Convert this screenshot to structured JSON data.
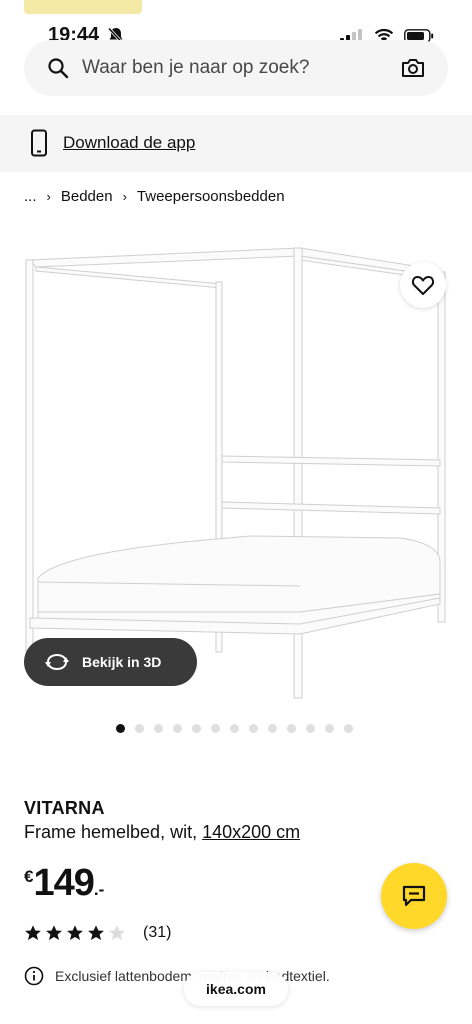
{
  "status_bar": {
    "time": "19:44"
  },
  "search": {
    "placeholder": "Waar ben je naar op zoek?"
  },
  "app_banner": {
    "label": "Download de app"
  },
  "breadcrumb": {
    "ellipsis": "...",
    "items": [
      "Bedden",
      "Tweepersoonsbedden"
    ]
  },
  "gallery": {
    "view3d_label": "Bekijk in 3D",
    "image_count": 13,
    "active_index": 0
  },
  "product": {
    "name": "VITARNA",
    "description": "Frame hemelbed, wit,",
    "dimensions": "140x200 cm",
    "price": {
      "currency": "€",
      "amount": "149",
      "suffix": ".-"
    },
    "rating": {
      "stars": 4,
      "max": 5,
      "review_count": "(31)"
    },
    "info": "Exclusief lattenbodem, matras en bedtextiel."
  },
  "browser": {
    "url": "ikea.com"
  },
  "colors": {
    "brand_yellow": "#ffd82a",
    "dark_button": "#3a3a3a",
    "banner_bg": "#f5f5f5"
  },
  "icons": [
    "bell-off-icon",
    "signal-icon",
    "wifi-icon",
    "battery-icon",
    "search-icon",
    "camera-icon",
    "phone-icon",
    "chevron-right-icon",
    "heart-icon",
    "rotate-3d-icon",
    "chat-icon",
    "star-icon",
    "info-icon"
  ]
}
